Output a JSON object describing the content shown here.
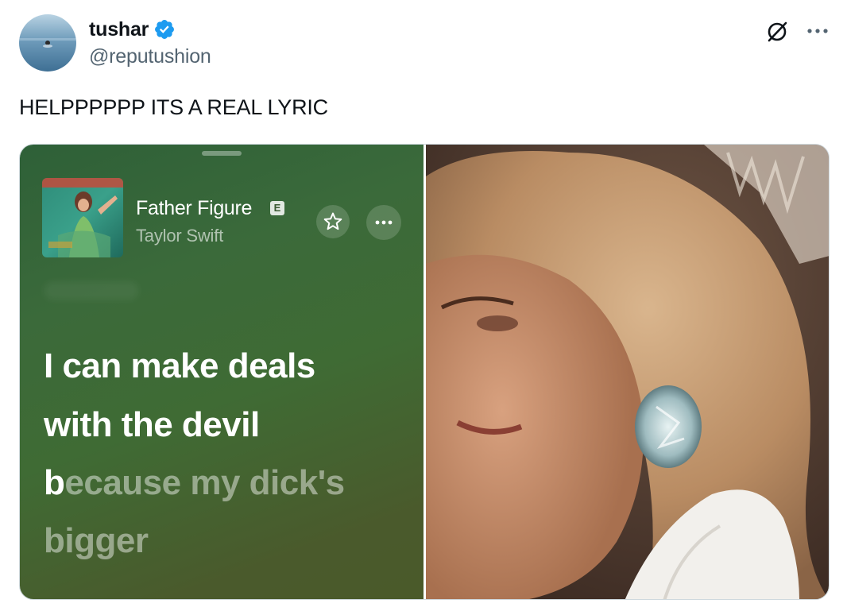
{
  "tweet": {
    "author": {
      "display_name": "tushar",
      "handle": "@reputushion",
      "verified": true
    },
    "text": "HELPPPPPP ITS A REAL LYRIC"
  },
  "icons": {
    "verified": "verified-badge-icon",
    "grok": "grok-icon",
    "more": "more-icon"
  },
  "media": {
    "now_playing": {
      "song_title": "Father Figure",
      "explicit_label": "E",
      "artist": "Taylor Swift",
      "lyrics": {
        "line1": "I can make deals",
        "line2": "with the devil",
        "line3_first": "b",
        "line3_rest": "ecause my dick's",
        "line4": "bigger"
      }
    }
  },
  "colors": {
    "verified_blue": "#1d9bf0",
    "text_primary": "#0f1419",
    "text_secondary": "#536471"
  }
}
